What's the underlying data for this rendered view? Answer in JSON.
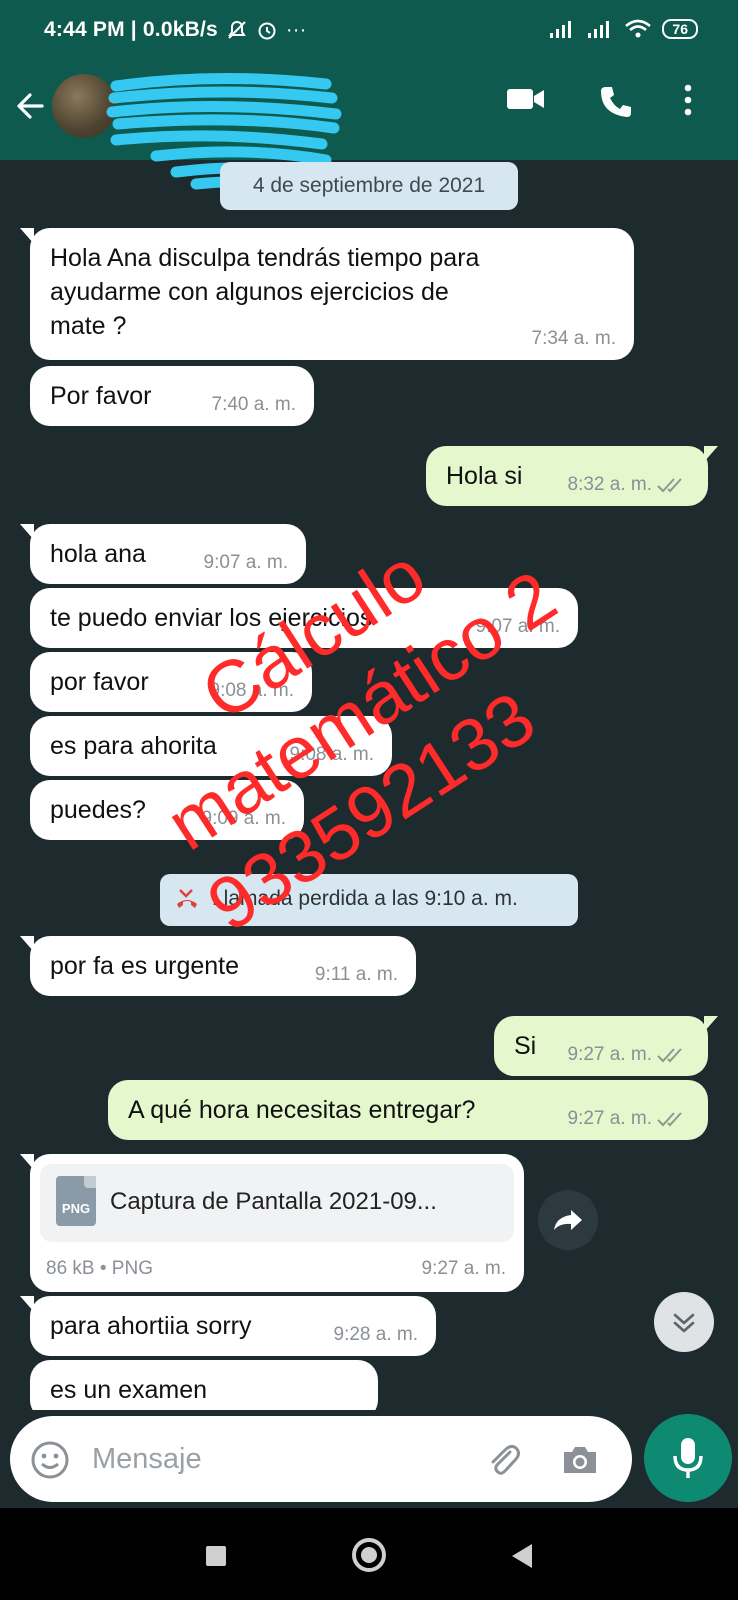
{
  "status_bar": {
    "time_and_speed": "4:44 PM | 0.0kB/s",
    "more_indicator": "···",
    "battery": "76"
  },
  "header": {
    "contact_name_redacted": true
  },
  "chat": {
    "date_separator": "4 de septiembre de 2021",
    "messages": [
      {
        "dir": "in",
        "text": "Hola Ana disculpa tendrás tiempo para\nayudarme con algunos ejercicios de\nmate ?",
        "time": "7:34 a. m."
      },
      {
        "dir": "in",
        "text": "Por favor",
        "time": "7:40 a. m."
      },
      {
        "dir": "out",
        "text": "Hola si",
        "time": "8:32 a. m.",
        "status": "read"
      },
      {
        "dir": "in",
        "text": "hola ana",
        "time": "9:07 a. m."
      },
      {
        "dir": "in",
        "text": "te puedo enviar los ejercicios",
        "time": "9:07 a. m."
      },
      {
        "dir": "in",
        "text": "por favor",
        "time": "9:08 a. m."
      },
      {
        "dir": "in",
        "text": "es para ahorita",
        "time": "9:08 a. m."
      },
      {
        "dir": "in",
        "text": "puedes?",
        "time": "9:09 a. m."
      },
      {
        "dir": "in",
        "text": "por fa es urgente",
        "time": "9:11 a. m."
      },
      {
        "dir": "out",
        "text": "Si",
        "time": "9:27 a. m.",
        "status": "read"
      },
      {
        "dir": "out",
        "text": "A qué hora necesitas entregar?",
        "time": "9:27 a. m.",
        "status": "read"
      },
      {
        "dir": "in",
        "text": "para ahortiia sorry",
        "time": "9:28 a. m."
      },
      {
        "dir": "in",
        "text": "es un examen",
        "time": ""
      }
    ],
    "missed_call": "Llamada perdida a las 9:10 a. m.",
    "file": {
      "name": "Captura de Pantalla 2021-09...",
      "type_label": "PNG",
      "meta": "86 kB • PNG",
      "time": "9:27 a. m."
    }
  },
  "watermark": {
    "line1": "Cálculo",
    "line2": "matemático 2",
    "line3": "933592133",
    "color": "#ff2a2a"
  },
  "input_bar": {
    "placeholder": "Mensaje"
  },
  "colors": {
    "header": "#0f5a4e",
    "chat_bg": "#1d2a2e",
    "incoming": "#ffffff",
    "outgoing": "#e4f7cd",
    "mic": "#0f8a72"
  }
}
